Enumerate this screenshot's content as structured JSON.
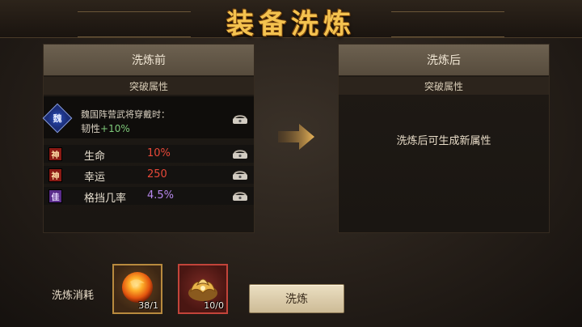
{
  "title": "装备洗炼",
  "before_panel": {
    "header": "洗炼前",
    "subheader": "突破属性",
    "breakthrough": {
      "gem_label": "魏",
      "line1": "魏国阵营武将穿戴时：",
      "line2_text": "韧性",
      "line2_value": "+10%"
    },
    "stats": [
      {
        "badge": "神",
        "name": "生命",
        "value": "10%",
        "color": "#e84838"
      },
      {
        "badge": "神",
        "name": "幸运",
        "value": "250",
        "color": "#e84838"
      },
      {
        "badge": "佳",
        "name": "格挡几率",
        "value": "4.5%",
        "color": "#b888ee"
      }
    ]
  },
  "after_panel": {
    "header": "洗炼后",
    "subheader": "突破属性",
    "message": "洗炼后可生成新属性"
  },
  "cost": {
    "label": "洗炼消耗",
    "items": [
      {
        "icon": "fire-orb-icon",
        "count": "38/1"
      },
      {
        "icon": "golden-lotus-icon",
        "count": "10/0"
      }
    ]
  },
  "wash_button": "洗炼"
}
